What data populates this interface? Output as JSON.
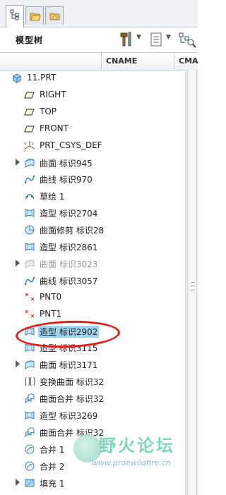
{
  "panel": {
    "title": "模型树",
    "columns": [
      "CNAME",
      "CMA"
    ]
  },
  "tree": {
    "items": [
      {
        "label": "11.PRT",
        "icon": "part-icon",
        "expander": false,
        "dim": false,
        "selected": false
      },
      {
        "label": "RIGHT",
        "icon": "datum-plane-icon",
        "expander": false,
        "dim": false,
        "selected": false
      },
      {
        "label": "TOP",
        "icon": "datum-plane-icon",
        "expander": false,
        "dim": false,
        "selected": false
      },
      {
        "label": "FRONT",
        "icon": "datum-plane-icon",
        "expander": false,
        "dim": false,
        "selected": false
      },
      {
        "label": "PRT_CSYS_DEF",
        "icon": "csys-icon",
        "expander": false,
        "dim": false,
        "selected": false
      },
      {
        "label": "曲面 标识945",
        "icon": "surface-icon",
        "expander": true,
        "dim": false,
        "selected": false
      },
      {
        "label": "曲线 标识970",
        "icon": "curve-icon",
        "expander": false,
        "dim": false,
        "selected": false
      },
      {
        "label": "草绘 1",
        "icon": "sketch-icon",
        "expander": false,
        "dim": false,
        "selected": false
      },
      {
        "label": "造型 标识2704",
        "icon": "style-icon",
        "expander": false,
        "dim": false,
        "selected": false
      },
      {
        "label": "曲面修剪 标识28",
        "icon": "surface-trim-icon",
        "expander": false,
        "dim": false,
        "selected": false
      },
      {
        "label": "造型 标识2861",
        "icon": "style-icon",
        "expander": false,
        "dim": false,
        "selected": false
      },
      {
        "label": "曲面 标识3023",
        "icon": "surface-icon",
        "expander": true,
        "dim": true,
        "selected": false
      },
      {
        "label": "曲线 标识3057",
        "icon": "curve-icon",
        "expander": false,
        "dim": false,
        "selected": false
      },
      {
        "label": "PNT0",
        "icon": "point-icon",
        "expander": false,
        "dim": false,
        "selected": false
      },
      {
        "label": "PNT1",
        "icon": "point-icon",
        "expander": false,
        "dim": false,
        "selected": false
      },
      {
        "label": "造型 标识2902",
        "icon": "style-icon",
        "expander": false,
        "dim": false,
        "selected": true
      },
      {
        "label": "造型 标识3115",
        "icon": "style-icon",
        "expander": false,
        "dim": false,
        "selected": false
      },
      {
        "label": "曲面 标识3171",
        "icon": "surface-icon",
        "expander": true,
        "dim": false,
        "selected": false
      },
      {
        "label": "变换曲面 标识32",
        "icon": "transform-surface-icon",
        "expander": false,
        "dim": false,
        "selected": false
      },
      {
        "label": "曲面合并 标识32",
        "icon": "surface-merge-icon",
        "expander": false,
        "dim": false,
        "selected": false
      },
      {
        "label": "造型 标识3269",
        "icon": "style-icon",
        "expander": false,
        "dim": false,
        "selected": false
      },
      {
        "label": "曲面合并 标识32",
        "icon": "surface-merge-icon",
        "expander": false,
        "dim": false,
        "selected": false
      },
      {
        "label": "合并 1",
        "icon": "merge-icon",
        "expander": false,
        "dim": false,
        "selected": false
      },
      {
        "label": "合并 2",
        "icon": "merge-icon",
        "expander": false,
        "dim": false,
        "selected": false
      },
      {
        "label": "填充 1",
        "icon": "fill-icon",
        "expander": true,
        "dim": false,
        "selected": false
      }
    ]
  },
  "watermark": {
    "title": "野火论坛",
    "url": "www.proewildfire.cn"
  },
  "colors": {
    "selection": "#9fd3f2",
    "annotation": "#e01d1d",
    "dim_text": "#9a9a9a"
  }
}
